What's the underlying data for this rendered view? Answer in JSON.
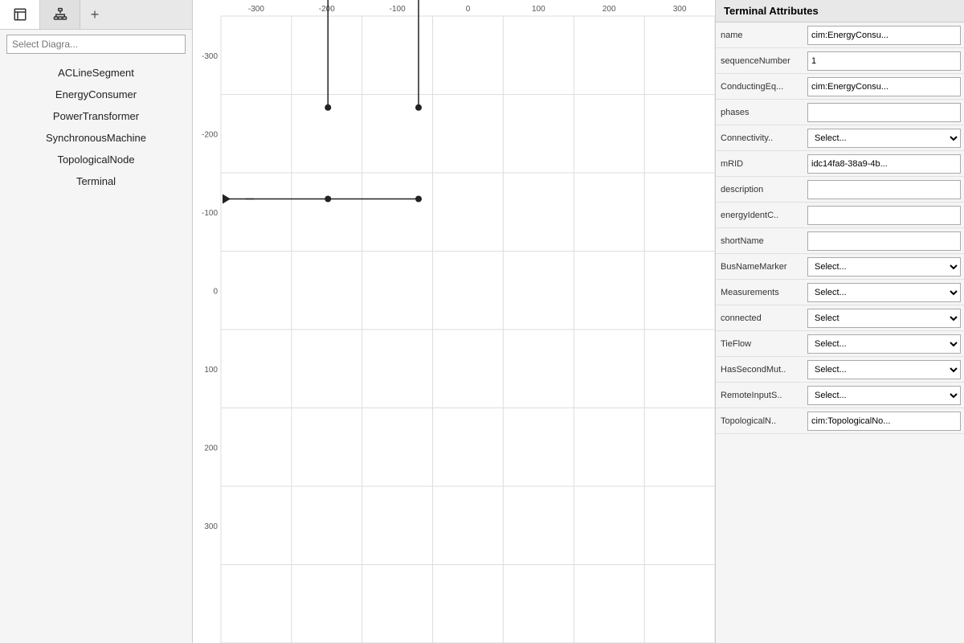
{
  "sidebar": {
    "tabs": [
      {
        "label": "diagram-tab",
        "icon": "diagram"
      },
      {
        "label": "hierarchy-tab",
        "icon": "hierarchy"
      }
    ],
    "add_label": "+",
    "select_placeholder": "Select Diagra...",
    "nav_items": [
      {
        "label": "ACLineSegment"
      },
      {
        "label": "EnergyConsumer"
      },
      {
        "label": "PowerTransformer"
      },
      {
        "label": "SynchronousMachine"
      },
      {
        "label": "TopologicalNode"
      },
      {
        "label": "Terminal"
      }
    ]
  },
  "canvas": {
    "x_labels": [
      "-300",
      "-200",
      "-100",
      "0",
      "100",
      "200",
      "300"
    ],
    "y_labels": [
      "-300",
      "-200",
      "-100",
      "0",
      "100",
      "200",
      "300"
    ]
  },
  "right_panel": {
    "title": "Terminal Attributes",
    "attributes": [
      {
        "label": "name",
        "type": "text",
        "value": "cim:EnergyConsu..."
      },
      {
        "label": "sequenceNumber",
        "type": "text",
        "value": "1"
      },
      {
        "label": "ConductingEq...",
        "type": "text",
        "value": "cim:EnergyConsu..."
      },
      {
        "label": "phases",
        "type": "text",
        "value": ""
      },
      {
        "label": "Connectivity..",
        "type": "select",
        "value": "Select..."
      },
      {
        "label": "mRID",
        "type": "text",
        "value": "idc14fa8-38a9-4b..."
      },
      {
        "label": "description",
        "type": "text",
        "value": ""
      },
      {
        "label": "energyIdentC..",
        "type": "text",
        "value": ""
      },
      {
        "label": "shortName",
        "type": "text",
        "value": ""
      },
      {
        "label": "BusNameMarker",
        "type": "select",
        "value": "Select..."
      },
      {
        "label": "Measurements",
        "type": "select",
        "value": "Select..."
      },
      {
        "label": "connected",
        "type": "select",
        "value": "Select"
      },
      {
        "label": "TieFlow",
        "type": "select",
        "value": "Select..."
      },
      {
        "label": "HasSecondMut..",
        "type": "select",
        "value": "Select..."
      },
      {
        "label": "RemoteInputS..",
        "type": "select",
        "value": "Select..."
      },
      {
        "label": "TopologicalN..",
        "type": "text",
        "value": "cim:TopologicalNo..."
      }
    ]
  }
}
